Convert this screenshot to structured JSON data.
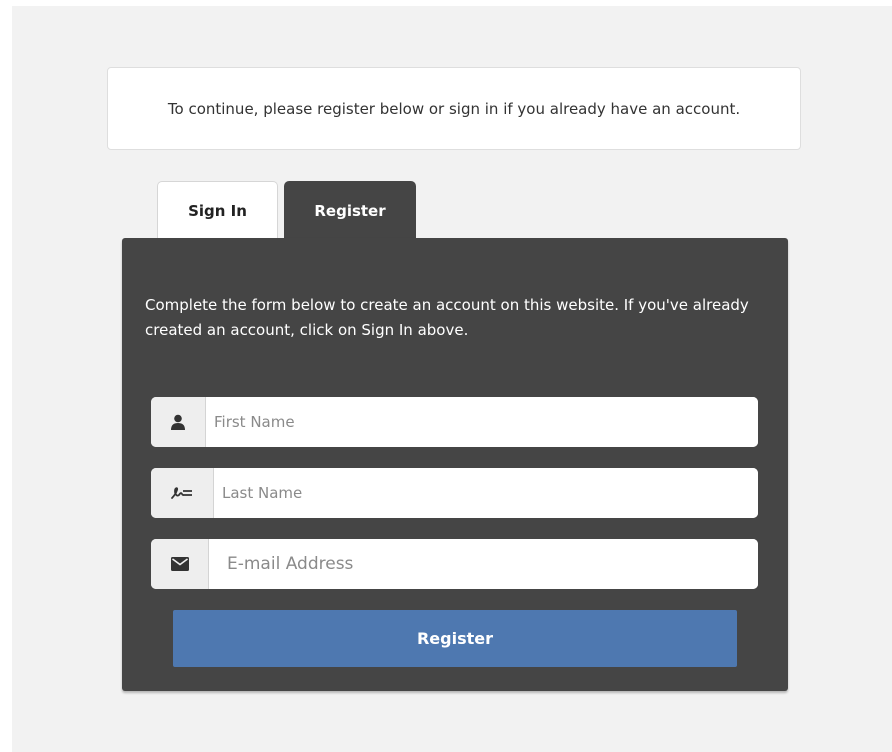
{
  "notice": {
    "text": "To continue, please register below or sign in if you already have an account."
  },
  "tabs": [
    {
      "label": "Sign In",
      "active": false
    },
    {
      "label": "Register",
      "active": true
    }
  ],
  "form": {
    "intro": "Complete the form below to create an account on this website. If you've already created an account, click on Sign In above.",
    "fields": [
      {
        "placeholder": "First Name",
        "value": "",
        "icon": "user-icon"
      },
      {
        "placeholder": "Last Name",
        "value": "",
        "icon": "signature-icon"
      },
      {
        "placeholder": "E-mail Address",
        "value": "",
        "icon": "envelope-icon"
      }
    ],
    "submit_label": "Register"
  },
  "colors": {
    "panel": "#454545",
    "page_background": "#f2f2f2",
    "button": "#4e78b0"
  }
}
